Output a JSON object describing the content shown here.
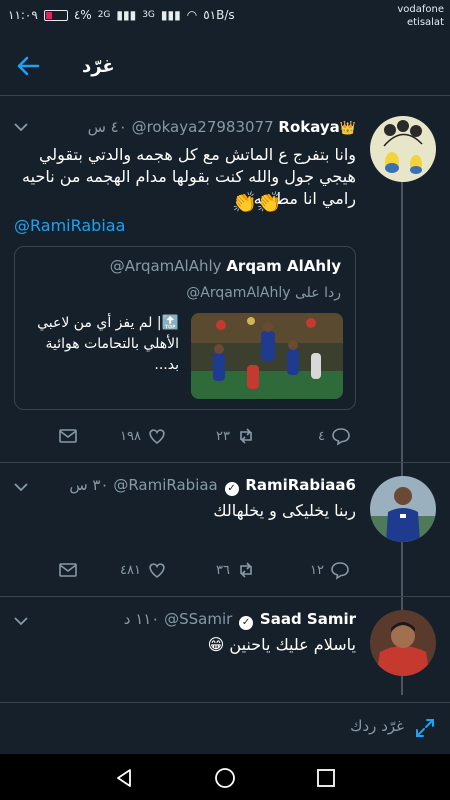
{
  "status_bar": {
    "time": "١١:٠٩",
    "battery": "٤%",
    "net1": "2G",
    "net2": "3G",
    "speed": "٥١B/s",
    "carrier1": "vodafone",
    "carrier2": "etisalat"
  },
  "header": {
    "title": "غرّد"
  },
  "tweets": [
    {
      "name": "Rokaya",
      "handle": "@rokaya27983077",
      "time": "٤٠ س",
      "text": "وانا بتفرج ع الماتش مع كل هجمه والدتي بتقولي هيجي جول والله كنت بقولها مدام الهجمه من ناحيه رامي انا مطمنه",
      "emoji": "👏👏",
      "mention": "@RamiRabiaa",
      "quote": {
        "name": "Arqam AlAhly",
        "handle": "@ArqamAlAhly",
        "reply_to_label": "ردا على",
        "reply_to_handle": "@ArqamAlAhly",
        "text": "🔝| لم يفز أي من لاعبي الأهلي بالتحامات هوائية بد..."
      },
      "retweets": "٢٣",
      "likes": "١٩٨",
      "replies": "٤"
    },
    {
      "name": "RamiRabiaa6",
      "handle": "@RamiRabiaa",
      "time": "٣٠ س",
      "text": "ربنا يخليكى و يخلهالك",
      "retweets": "٣٦",
      "likes": "٤٨١",
      "replies": "١٢"
    },
    {
      "name": "Saad Samir",
      "handle": "@SSamir",
      "time": "١١٠ د",
      "text": "ياسلام عليك ياحنين 😁"
    }
  ],
  "reply_bar": {
    "placeholder": "غرّد ردك"
  },
  "colors": {
    "background": "#15202b",
    "accent": "#1da1f2",
    "muted": "#8899a6",
    "divider": "#38444d"
  }
}
